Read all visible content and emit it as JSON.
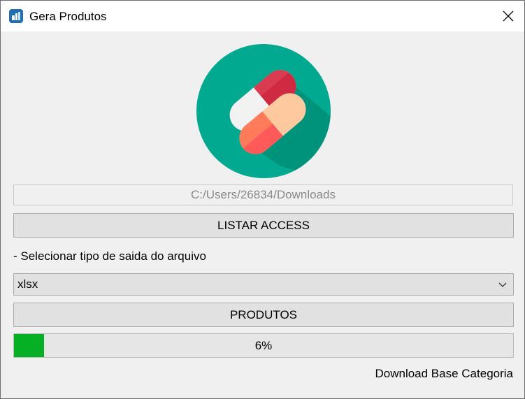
{
  "window": {
    "title": "Gera Produtos",
    "app_icon": "medication-app-icon",
    "close_icon": "close-icon"
  },
  "logo": {
    "icon": "pills-capsule-logo",
    "circle_color": "#00a98f"
  },
  "path_field": {
    "value": "C:/Users/26834/Downloads"
  },
  "buttons": {
    "listar_label": "LISTAR ACCESS",
    "produtos_label": "PRODUTOS"
  },
  "output_type": {
    "label": "- Selecionar tipo de saida do arquivo",
    "selected": "xlsx",
    "icon": "chevron-down-icon"
  },
  "progress": {
    "value": 0.06,
    "label": "6%",
    "color": "#06b025"
  },
  "download_link": {
    "label": "Download Base Categoria"
  }
}
